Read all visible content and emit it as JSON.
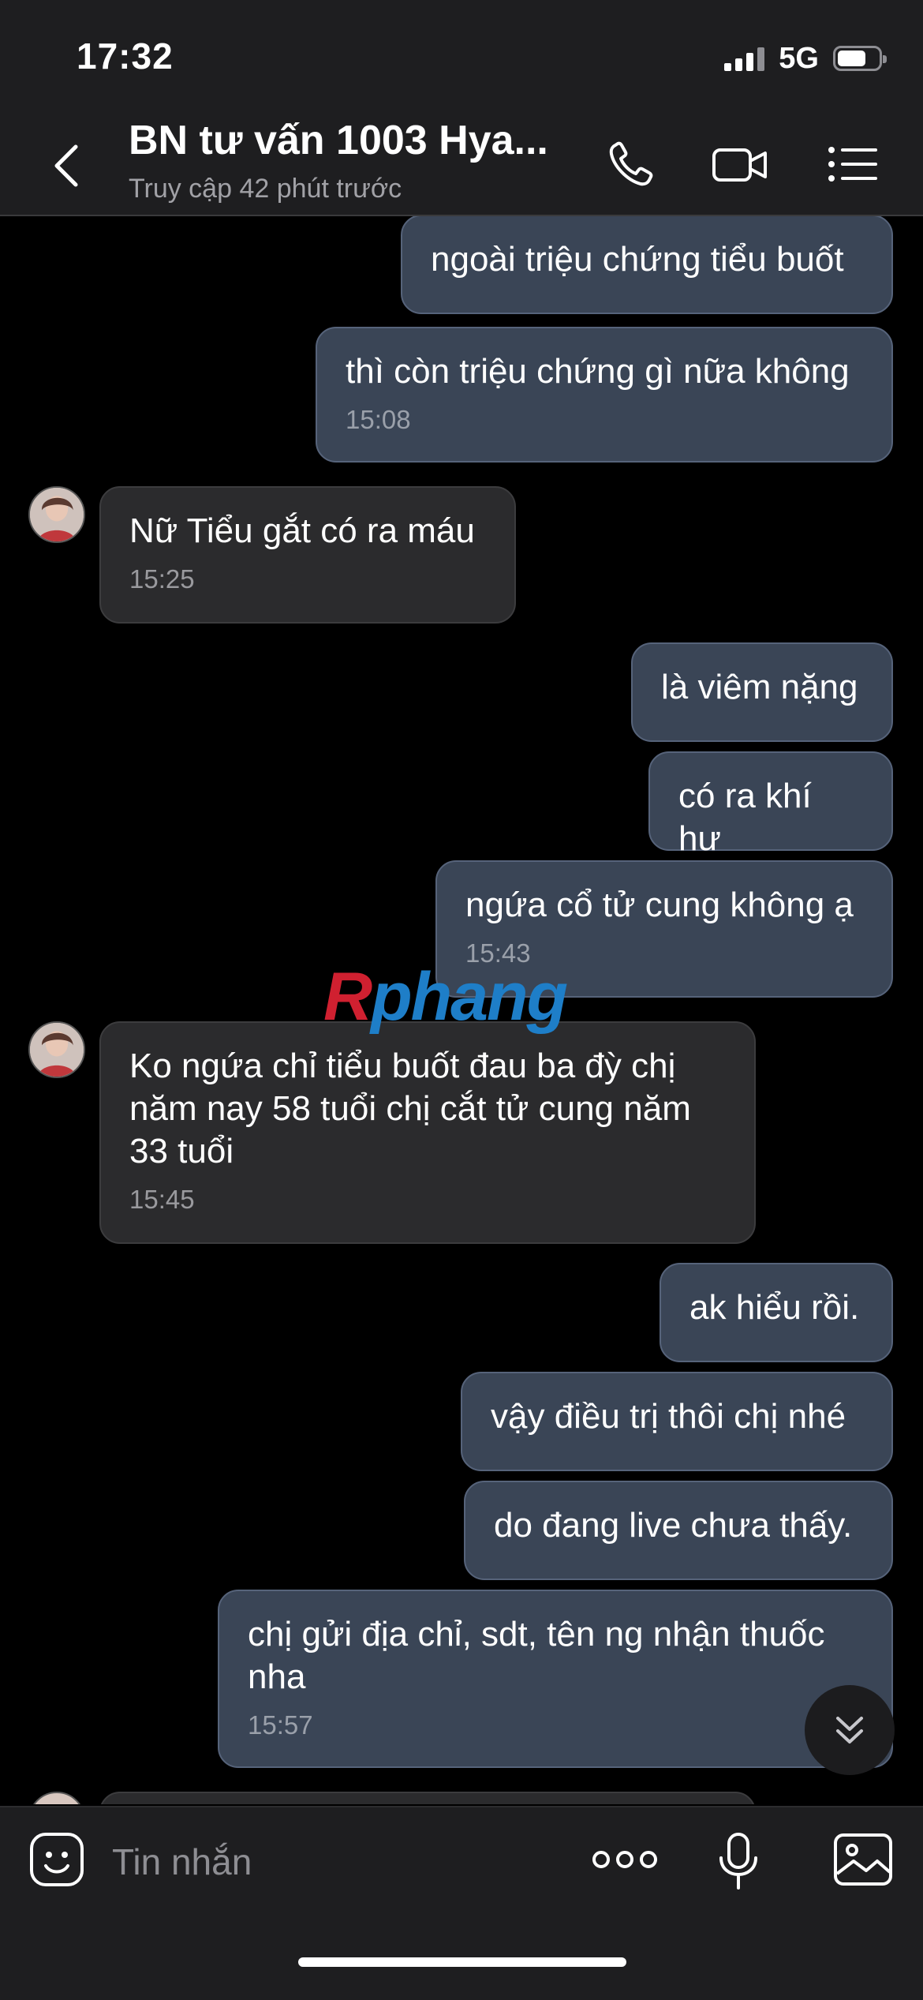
{
  "status": {
    "time": "17:32",
    "network": "5G"
  },
  "header": {
    "title": "BN tư vấn 1003 Hya...",
    "subtitle": "Truy cập 42 phút trước"
  },
  "messages": [
    {
      "dir": "out",
      "text": "ngoài triệu chứng tiểu buốt",
      "time": ""
    },
    {
      "dir": "out",
      "text": "thì còn triệu chứng gì nữa không",
      "time": "15:08"
    },
    {
      "dir": "in",
      "text": "Nữ Tiểu gắt có ra máu",
      "time": "15:25"
    },
    {
      "dir": "out",
      "text": "là viêm nặng",
      "time": ""
    },
    {
      "dir": "out",
      "text": "có ra khí hư",
      "time": ""
    },
    {
      "dir": "out",
      "text": "ngứa cổ tử cung không ạ",
      "time": "15:43"
    },
    {
      "dir": "in",
      "text": "Ko ngứa chỉ tiểu buốt đau ba đỳ chị năm nay 58 tuổi chị cắt tử cung năm 33 tuổi",
      "time": "15:45"
    },
    {
      "dir": "out",
      "text": "ak hiểu rồi.",
      "time": ""
    },
    {
      "dir": "out",
      "text": "vậy điều trị thôi chị nhé",
      "time": ""
    },
    {
      "dir": "out",
      "text": "do đang live chưa thấy.",
      "time": ""
    },
    {
      "dir": "out",
      "text": "chị gửi địa chỉ, sdt, tên ng nhận thuốc nha",
      "time": "15:57"
    }
  ],
  "watermark": {
    "part1": "R",
    "part2": "phang"
  },
  "input": {
    "placeholder": "Tin nhắn"
  },
  "colors": {
    "outgoing_bubble": "#3a4556",
    "incoming_bubble": "#2b2b2d",
    "background": "#000000"
  },
  "icons": [
    "back-icon",
    "phone-icon",
    "video-call-icon",
    "menu-list-icon",
    "sticker-icon",
    "more-icon",
    "microphone-icon",
    "gallery-icon",
    "scroll-down-icon"
  ]
}
